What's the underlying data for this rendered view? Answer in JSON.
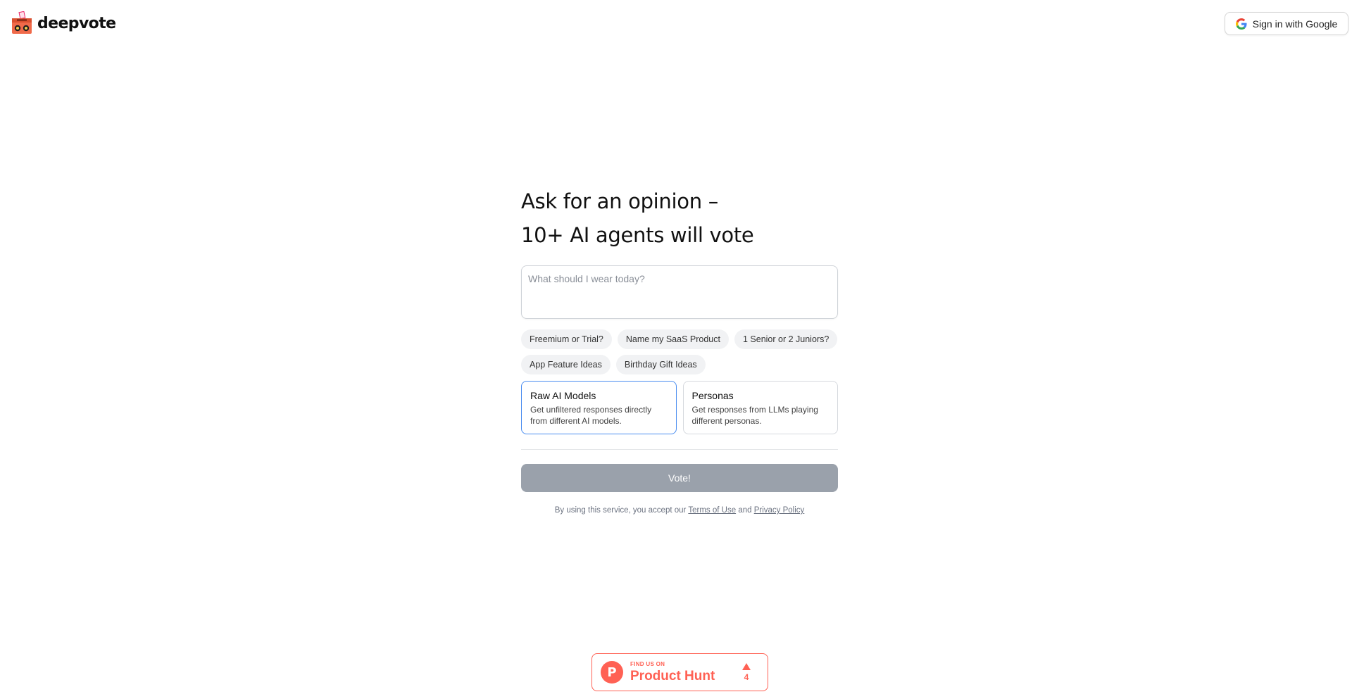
{
  "brand": {
    "name": "deepvote"
  },
  "header": {
    "signin_label": "Sign in with Google"
  },
  "hero": {
    "line1": "Ask for an opinion –",
    "line2": "10+ AI agents will vote"
  },
  "prompt": {
    "placeholder": "What should I wear today?",
    "value": ""
  },
  "suggestions": [
    "Freemium or Trial?",
    "Name my SaaS Product",
    "1 Senior or 2 Juniors?",
    "App Feature Ideas",
    "Birthday Gift Ideas"
  ],
  "modes": [
    {
      "title": "Raw AI Models",
      "description": "Get unfiltered responses directly from different AI models.",
      "selected": true
    },
    {
      "title": "Personas",
      "description": "Get responses from LLMs playing different personas.",
      "selected": false
    }
  ],
  "vote_label": "Vote!",
  "legal": {
    "prefix": "By using this service, you accept our",
    "terms": "Terms of Use",
    "and": "and",
    "privacy": "Privacy Policy"
  },
  "product_hunt": {
    "small": "FIND US ON",
    "name": "Product Hunt",
    "votes": "4"
  },
  "colors": {
    "accent": "#4a8df0",
    "vote_disabled": "#9aa1ab",
    "product_hunt": "#ff6154"
  }
}
